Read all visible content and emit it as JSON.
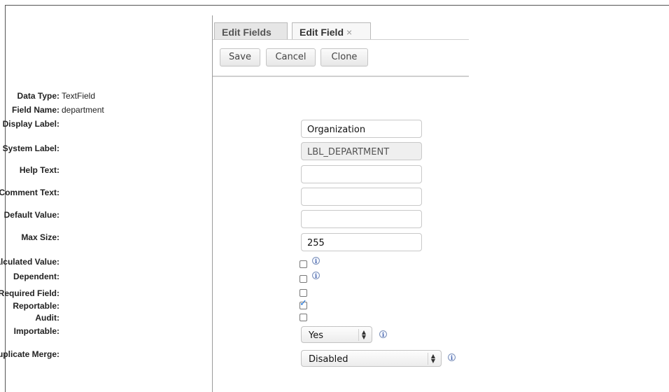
{
  "tabs": [
    {
      "label": "Edit Fields"
    },
    {
      "label": "Edit Field",
      "close": "×"
    }
  ],
  "toolbar": {
    "save_label": "Save",
    "cancel_label": "Cancel",
    "clone_label": "Clone"
  },
  "info": {
    "data_type_label": "Data Type:",
    "data_type_value": "TextField",
    "field_name_label": "Field Name:",
    "field_name_value": "department"
  },
  "fields": {
    "display_label": {
      "label": "Display Label:",
      "value": "Organization"
    },
    "system_label": {
      "label": "System Label:",
      "value": "LBL_DEPARTMENT"
    },
    "help_text": {
      "label": "Help Text:",
      "value": ""
    },
    "comment_text": {
      "label": "Comment Text:",
      "value": ""
    },
    "default_value": {
      "label": "Default Value:",
      "value": ""
    },
    "max_size": {
      "label": "Max Size:",
      "value": "255"
    }
  },
  "checkboxes": {
    "calculated_value": {
      "label": "Calculated Value:",
      "checked": false
    },
    "dependent": {
      "label": "Dependent:",
      "checked": false
    },
    "required_field": {
      "label": "Required Field:",
      "checked": false
    },
    "reportable": {
      "label": "Reportable:",
      "checked": true
    },
    "audit": {
      "label": "Audit:",
      "checked": false
    }
  },
  "selects": {
    "importable": {
      "label": "Importable:",
      "value": "Yes"
    },
    "duplicate_merge": {
      "label": "Duplicate Merge:",
      "value": "Disabled"
    }
  },
  "icons": {
    "info_glyph": "i",
    "select_arrows": "▲▼",
    "checkmark": "✓"
  },
  "colors": {
    "info_icon": "#3b5ba8",
    "checkmark": "#1e73d8"
  }
}
